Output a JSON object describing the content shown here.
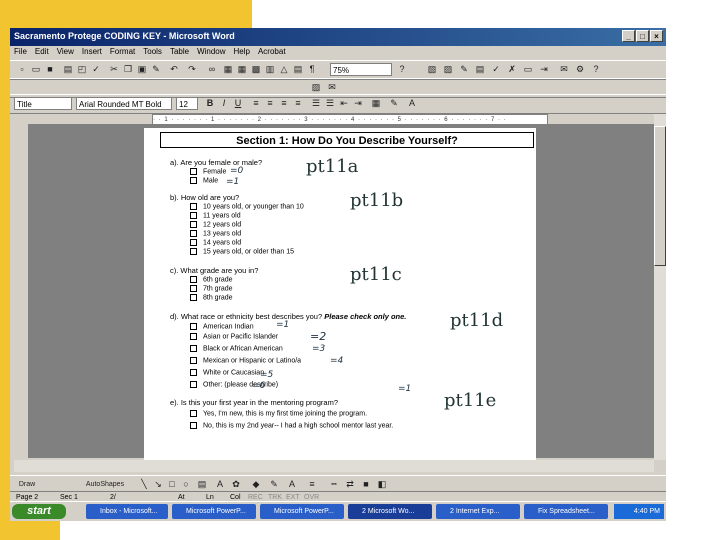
{
  "window": {
    "title": "Sacramento Protege CODING KEY - Microsoft Word",
    "controls": [
      "_",
      "□",
      "×"
    ]
  },
  "menu": [
    "File",
    "Edit",
    "View",
    "Insert",
    "Format",
    "Tools",
    "Table",
    "Window",
    "Help",
    "Acrobat"
  ],
  "toolbar": {
    "zoom": "75%",
    "style": "Title",
    "font": "Arial Rounded MT Bold",
    "font_size": "12"
  },
  "ruler": "· · 1 · · · · · · · 1 · · · · · · · 2 · · · · · · · 3 · · · · · · · 4 · · · · · · · 5 · · · · · · · 6 · · · · · · · 7 · ·",
  "document": {
    "section_title": "Section 1:  How Do You Describe Yourself?",
    "q_a": {
      "question": "a). Are you female or male?",
      "options": [
        "Female",
        "Male"
      ],
      "marks": [
        "=0",
        "=1"
      ],
      "code": "pt11a"
    },
    "q_b": {
      "question": "b). How old are you?",
      "options": [
        "10 years old, or younger than 10",
        "11 years old",
        "12 years old",
        "13 years old",
        "14 years old",
        "15 years old, or older than 15"
      ],
      "code": "pt11b"
    },
    "q_c": {
      "question": "c). What grade are you in?",
      "options": [
        "6th grade",
        "7th grade",
        "8th grade"
      ],
      "code": "pt11c"
    },
    "q_d": {
      "question_plain": "d). What race or ethnicity best describes you?",
      "question_emph": "Please check only one.",
      "options": [
        "American Indian",
        "Asian or Pacific Islander",
        "Black or African American",
        "Mexican or Hispanic or Latino/a",
        "White or Caucasian",
        "Other:  (please describe)"
      ],
      "marks": [
        "=1",
        "=2",
        "=3",
        "=4",
        "=5",
        "=6"
      ],
      "code": "pt11d"
    },
    "q_e": {
      "question": "e). Is this your first year in the mentoring program?",
      "options": [
        "Yes, I'm new, this is my first time joining the program.",
        "No, this is my 2nd year-- I had a high school mentor last year."
      ],
      "mark": "=1",
      "code": "pt11e"
    }
  },
  "drawing_toolbar": {
    "draw": "Draw",
    "autoshapes": "AutoShapes"
  },
  "status": [
    "Page 2",
    "Sec 1",
    "2/",
    "At",
    "Ln",
    "Col",
    "REC",
    "TRK",
    "EXT",
    "OVR"
  ],
  "taskbar": {
    "start": "start",
    "tasks": [
      "Inbox - Microsoft...",
      "Microsoft PowerP...",
      "Microsoft PowerP...",
      "2 Microsoft Wo...",
      "2 Internet Exp...",
      "Fix Spreadsheet..."
    ],
    "clock": "4:40 PM"
  }
}
